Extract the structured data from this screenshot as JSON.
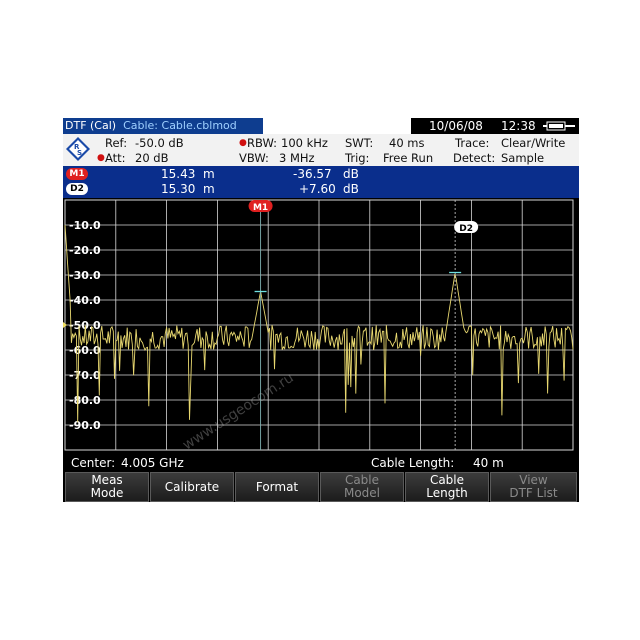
{
  "title": {
    "mode": "DTF (Cal)",
    "cable": "Cable: Cable.cblmod",
    "date": "10/06/08",
    "time": "12:38"
  },
  "settings": {
    "ref_label": "Ref:",
    "ref_value": "-50.0 dB",
    "att_label": "Att:",
    "att_value": "20 dB",
    "rbw_label": "RBW:",
    "rbw_value": "100 kHz",
    "vbw_label": "VBW:",
    "vbw_value": "3 MHz",
    "swt_label": "SWT:",
    "swt_value": "40 ms",
    "trig_label": "Trig:",
    "trig_value": "Free Run",
    "trace_label": "Trace:",
    "trace_value": "Clear/Write",
    "detect_label": "Detect:",
    "detect_value": "Sample"
  },
  "markers": [
    {
      "id": "M1",
      "distance": "15.43",
      "dist_unit": "m",
      "value": "-36.57",
      "value_unit": "dB"
    },
    {
      "id": "D2",
      "distance": "15.30",
      "dist_unit": "m",
      "value": "+7.60",
      "value_unit": "dB"
    }
  ],
  "plot": {
    "y_ticks": [
      "-10.0",
      "-20.0",
      "-30.0",
      "-40.0",
      "-50.0",
      "-60.0",
      "-70.0",
      "-80.0",
      "-90.0"
    ],
    "marker_m1": "M1",
    "marker_d2": "D2",
    "trace_color": "#e8d870",
    "grid_color": "#d8d8d8"
  },
  "footer": {
    "center_label": "Center:",
    "center_value": "4.005 GHz",
    "cable_length_label": "Cable Length:",
    "cable_length_value": "40 m"
  },
  "softkeys": [
    {
      "line1": "Meas",
      "line2": "Mode",
      "enabled": true
    },
    {
      "line1": "Calibrate",
      "line2": "",
      "enabled": true
    },
    {
      "line1": "Format",
      "line2": "",
      "enabled": true
    },
    {
      "line1": "Cable",
      "line2": "Model",
      "enabled": false
    },
    {
      "line1": "Cable",
      "line2": "Length",
      "enabled": true
    },
    {
      "line1": "View",
      "line2": "DTF List",
      "enabled": false
    }
  ],
  "watermark": "www.usgeocom.ru"
}
